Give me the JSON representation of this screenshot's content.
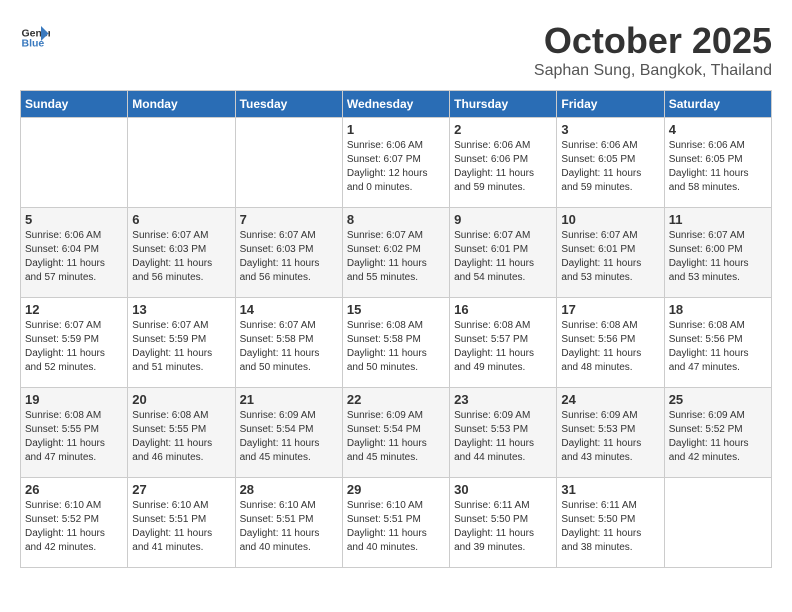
{
  "logo": {
    "general": "General",
    "blue": "Blue"
  },
  "title": {
    "month": "October 2025",
    "location": "Saphan Sung, Bangkok, Thailand"
  },
  "weekdays": [
    "Sunday",
    "Monday",
    "Tuesday",
    "Wednesday",
    "Thursday",
    "Friday",
    "Saturday"
  ],
  "weeks": [
    [
      {
        "day": "",
        "info": ""
      },
      {
        "day": "",
        "info": ""
      },
      {
        "day": "",
        "info": ""
      },
      {
        "day": "1",
        "info": "Sunrise: 6:06 AM\nSunset: 6:07 PM\nDaylight: 12 hours\nand 0 minutes."
      },
      {
        "day": "2",
        "info": "Sunrise: 6:06 AM\nSunset: 6:06 PM\nDaylight: 11 hours\nand 59 minutes."
      },
      {
        "day": "3",
        "info": "Sunrise: 6:06 AM\nSunset: 6:05 PM\nDaylight: 11 hours\nand 59 minutes."
      },
      {
        "day": "4",
        "info": "Sunrise: 6:06 AM\nSunset: 6:05 PM\nDaylight: 11 hours\nand 58 minutes."
      }
    ],
    [
      {
        "day": "5",
        "info": "Sunrise: 6:06 AM\nSunset: 6:04 PM\nDaylight: 11 hours\nand 57 minutes."
      },
      {
        "day": "6",
        "info": "Sunrise: 6:07 AM\nSunset: 6:03 PM\nDaylight: 11 hours\nand 56 minutes."
      },
      {
        "day": "7",
        "info": "Sunrise: 6:07 AM\nSunset: 6:03 PM\nDaylight: 11 hours\nand 56 minutes."
      },
      {
        "day": "8",
        "info": "Sunrise: 6:07 AM\nSunset: 6:02 PM\nDaylight: 11 hours\nand 55 minutes."
      },
      {
        "day": "9",
        "info": "Sunrise: 6:07 AM\nSunset: 6:01 PM\nDaylight: 11 hours\nand 54 minutes."
      },
      {
        "day": "10",
        "info": "Sunrise: 6:07 AM\nSunset: 6:01 PM\nDaylight: 11 hours\nand 53 minutes."
      },
      {
        "day": "11",
        "info": "Sunrise: 6:07 AM\nSunset: 6:00 PM\nDaylight: 11 hours\nand 53 minutes."
      }
    ],
    [
      {
        "day": "12",
        "info": "Sunrise: 6:07 AM\nSunset: 5:59 PM\nDaylight: 11 hours\nand 52 minutes."
      },
      {
        "day": "13",
        "info": "Sunrise: 6:07 AM\nSunset: 5:59 PM\nDaylight: 11 hours\nand 51 minutes."
      },
      {
        "day": "14",
        "info": "Sunrise: 6:07 AM\nSunset: 5:58 PM\nDaylight: 11 hours\nand 50 minutes."
      },
      {
        "day": "15",
        "info": "Sunrise: 6:08 AM\nSunset: 5:58 PM\nDaylight: 11 hours\nand 50 minutes."
      },
      {
        "day": "16",
        "info": "Sunrise: 6:08 AM\nSunset: 5:57 PM\nDaylight: 11 hours\nand 49 minutes."
      },
      {
        "day": "17",
        "info": "Sunrise: 6:08 AM\nSunset: 5:56 PM\nDaylight: 11 hours\nand 48 minutes."
      },
      {
        "day": "18",
        "info": "Sunrise: 6:08 AM\nSunset: 5:56 PM\nDaylight: 11 hours\nand 47 minutes."
      }
    ],
    [
      {
        "day": "19",
        "info": "Sunrise: 6:08 AM\nSunset: 5:55 PM\nDaylight: 11 hours\nand 47 minutes."
      },
      {
        "day": "20",
        "info": "Sunrise: 6:08 AM\nSunset: 5:55 PM\nDaylight: 11 hours\nand 46 minutes."
      },
      {
        "day": "21",
        "info": "Sunrise: 6:09 AM\nSunset: 5:54 PM\nDaylight: 11 hours\nand 45 minutes."
      },
      {
        "day": "22",
        "info": "Sunrise: 6:09 AM\nSunset: 5:54 PM\nDaylight: 11 hours\nand 45 minutes."
      },
      {
        "day": "23",
        "info": "Sunrise: 6:09 AM\nSunset: 5:53 PM\nDaylight: 11 hours\nand 44 minutes."
      },
      {
        "day": "24",
        "info": "Sunrise: 6:09 AM\nSunset: 5:53 PM\nDaylight: 11 hours\nand 43 minutes."
      },
      {
        "day": "25",
        "info": "Sunrise: 6:09 AM\nSunset: 5:52 PM\nDaylight: 11 hours\nand 42 minutes."
      }
    ],
    [
      {
        "day": "26",
        "info": "Sunrise: 6:10 AM\nSunset: 5:52 PM\nDaylight: 11 hours\nand 42 minutes."
      },
      {
        "day": "27",
        "info": "Sunrise: 6:10 AM\nSunset: 5:51 PM\nDaylight: 11 hours\nand 41 minutes."
      },
      {
        "day": "28",
        "info": "Sunrise: 6:10 AM\nSunset: 5:51 PM\nDaylight: 11 hours\nand 40 minutes."
      },
      {
        "day": "29",
        "info": "Sunrise: 6:10 AM\nSunset: 5:51 PM\nDaylight: 11 hours\nand 40 minutes."
      },
      {
        "day": "30",
        "info": "Sunrise: 6:11 AM\nSunset: 5:50 PM\nDaylight: 11 hours\nand 39 minutes."
      },
      {
        "day": "31",
        "info": "Sunrise: 6:11 AM\nSunset: 5:50 PM\nDaylight: 11 hours\nand 38 minutes."
      },
      {
        "day": "",
        "info": ""
      }
    ]
  ]
}
